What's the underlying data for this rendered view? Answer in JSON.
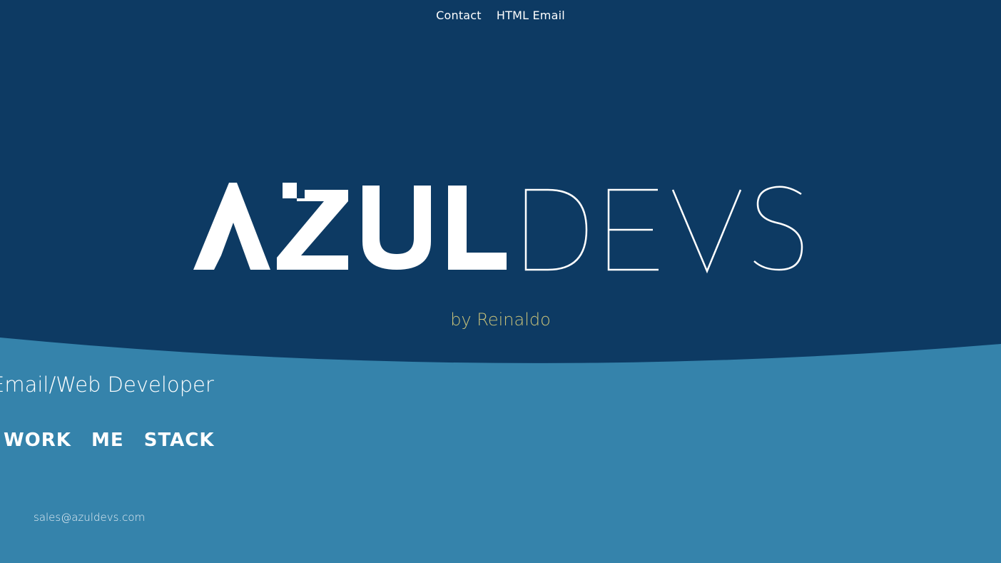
{
  "top_nav": {
    "contact_label": "Contact",
    "html_email_label": "HTML Email"
  },
  "logo": {
    "bold_text": "AZUL",
    "light_text": "DEVS"
  },
  "hero": {
    "tagline": "by Reinaldo"
  },
  "profile": {
    "role": "Email/Web Developer",
    "nav": {
      "work_label": "WORK",
      "me_label": "ME",
      "stack_label": "STACK"
    },
    "email": "sales@azuldevs.com"
  },
  "colors": {
    "hero_background": "#0d3a63",
    "lower_background": "#3583ab",
    "tagline": "#c8c27a",
    "text": "#ffffff"
  }
}
